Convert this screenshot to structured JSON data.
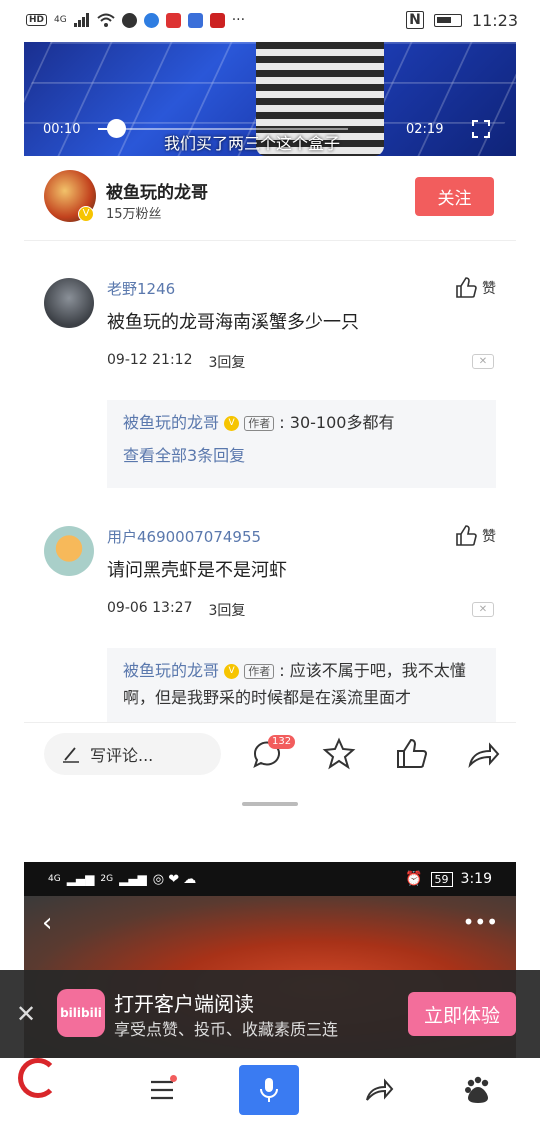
{
  "status_bar": {
    "network": "4G",
    "time": "11:23",
    "more": "···"
  },
  "video": {
    "current_time": "00:10",
    "duration": "02:19",
    "progress": 0.07,
    "subtitle": "我们买了两三个这个盒子"
  },
  "author": {
    "name": "被鱼玩的龙哥",
    "fans": "15万粉丝",
    "follow_label": "关注"
  },
  "comments": [
    {
      "user": "老野1246",
      "text": "被鱼玩的龙哥海南溪蟹多少一只",
      "time": "09-12 21:12",
      "replies": "3回复",
      "like_label": "赞",
      "reply": {
        "name": "被鱼玩的龙哥",
        "tag": "作者",
        "text": ": 30-100多都有",
        "more": "查看全部3条回复"
      }
    },
    {
      "user": "用户4690007074955",
      "text": "请问黑壳虾是不是河虾",
      "time": "09-06 13:27",
      "replies": "3回复",
      "like_label": "赞",
      "reply": {
        "name": "被鱼玩的龙哥",
        "tag": "作者",
        "text": ": 应该不属于吧，我不太懂啊，但是我野采的时候都是在溪流里面才"
      }
    }
  ],
  "toolbar": {
    "comment_placeholder": "写评论...",
    "comment_count": "132"
  },
  "embed": {
    "network_a": "4G",
    "network_b": "2G",
    "battery": "59",
    "time": "3:19"
  },
  "banner": {
    "logo_text": "bilibili",
    "title": "打开客户端阅读",
    "subtitle": "享受点赞、投币、收藏素质三连",
    "cta": "立即体验"
  },
  "colors": {
    "accent_red": "#f25d5d",
    "link_blue": "#5a78ad",
    "bili_pink": "#f36e9b",
    "mic_blue": "#3a7bf2"
  }
}
